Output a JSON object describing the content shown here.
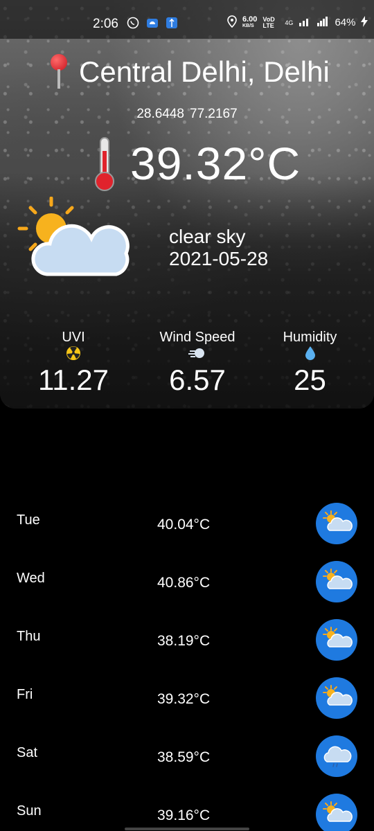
{
  "status_bar": {
    "time": "2:06",
    "net_speed_value": "6.00",
    "net_speed_unit": "KB/S",
    "vod_label": "VoD LTE",
    "net_type": "4G",
    "battery": "64%"
  },
  "location": {
    "name": "Central Delhi, Delhi",
    "lat": "28.6448",
    "lon": "77.2167"
  },
  "current": {
    "temperature": "39.32°C",
    "description": "clear sky",
    "date": "2021-05-28"
  },
  "stats": {
    "uvi_label": "UVI",
    "uvi_value": "11.27",
    "wind_label": "Wind Speed",
    "wind_value": "6.57",
    "humidity_label": "Humidity",
    "humidity_value": "25"
  },
  "forecast": [
    {
      "day": "Tue",
      "temp": "40.04°C",
      "icon": "sun-cloud-icon"
    },
    {
      "day": "Wed",
      "temp": "40.86°C",
      "icon": "sun-cloud-icon"
    },
    {
      "day": "Thu",
      "temp": "38.19°C",
      "icon": "sun-cloud-icon"
    },
    {
      "day": "Fri",
      "temp": "39.32°C",
      "icon": "sun-cloud-icon"
    },
    {
      "day": "Sat",
      "temp": "38.59°C",
      "icon": "rain-cloud-icon"
    },
    {
      "day": "Sun",
      "temp": "39.16°C",
      "icon": "sun-cloud-icon"
    }
  ],
  "colors": {
    "accent": "#1f7ae0",
    "background": "#000000"
  }
}
